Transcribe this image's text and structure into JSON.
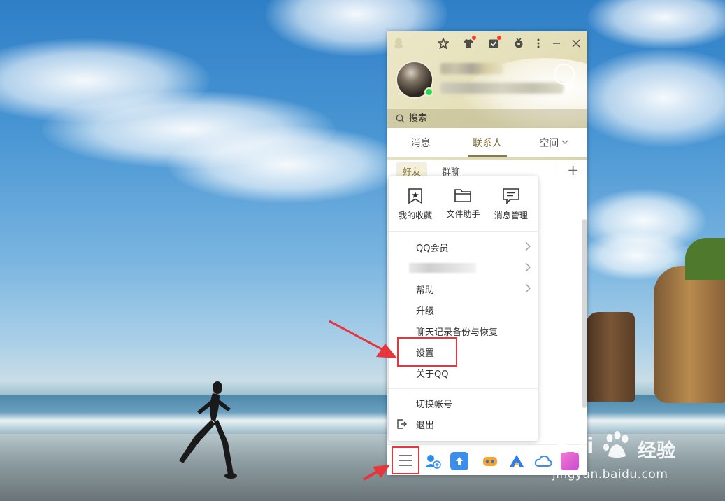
{
  "qq": {
    "search_placeholder": "搜索",
    "tabs": [
      {
        "label": "消息"
      },
      {
        "label": "联系人"
      },
      {
        "label": "空间"
      }
    ],
    "subtabs": [
      {
        "label": "好友"
      },
      {
        "label": "群聊"
      }
    ],
    "add_symbol": "+"
  },
  "menu": {
    "quick_actions": [
      {
        "label": "我的收藏",
        "icon": "bookmark-star-icon"
      },
      {
        "label": "文件助手",
        "icon": "folder-icon"
      },
      {
        "label": "消息管理",
        "icon": "message-manage-icon"
      }
    ],
    "items": [
      {
        "label": "QQ会员",
        "has_submenu": true
      },
      {
        "label": "",
        "has_submenu": true
      },
      {
        "label": "帮助",
        "has_submenu": true
      },
      {
        "label": "升级",
        "has_submenu": false
      },
      {
        "label": "聊天记录备份与恢复",
        "has_submenu": false
      },
      {
        "label": "设置",
        "has_submenu": false
      },
      {
        "label": "关于QQ",
        "has_submenu": false
      }
    ],
    "account_items": [
      {
        "label": "切换帐号"
      },
      {
        "label": "退出"
      }
    ]
  },
  "watermark": {
    "logo": "Bai",
    "logo2": "经验",
    "url": "jingyan.baidu.com"
  },
  "colors": {
    "accent": "#8c7a3c",
    "annotation_red": "#e8343b",
    "online_green": "#26d75a"
  }
}
